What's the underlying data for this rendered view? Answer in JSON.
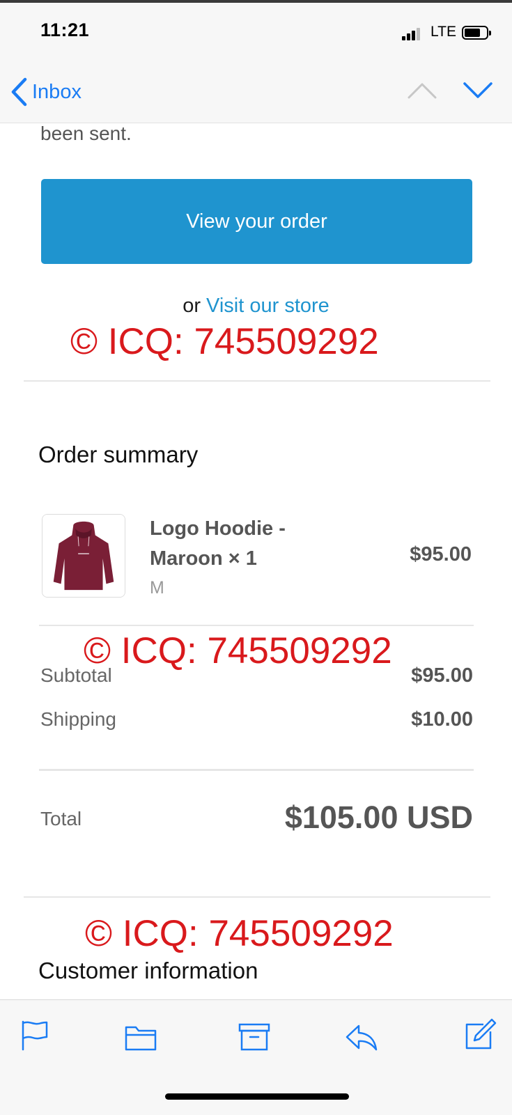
{
  "status_bar": {
    "time": "11:21",
    "network": "LTE"
  },
  "nav": {
    "back_label": "Inbox"
  },
  "email": {
    "sent_text": "been sent.",
    "view_order_label": "View your order",
    "or_text": "or",
    "visit_store_label": "Visit our store",
    "watermark_text": "© ICQ: 745509292",
    "order_summary_title": "Order summary",
    "item": {
      "name": "Logo Hoodie - Maroon × 1",
      "variant": "M",
      "price": "$95.00"
    },
    "subtotal_label": "Subtotal",
    "subtotal_value": "$95.00",
    "shipping_label": "Shipping",
    "shipping_value": "$10.00",
    "total_label": "Total",
    "total_value": "$105.00 USD",
    "customer_info_title": "Customer information"
  },
  "toolbar": {
    "icons": [
      "flag-icon",
      "folder-icon",
      "archive-icon",
      "reply-icon",
      "compose-icon"
    ]
  },
  "colors": {
    "accent_blue": "#1a7cf4",
    "button_blue": "#1f94cf",
    "watermark_red": "#d9191c",
    "hoodie_maroon": "#7a1f36"
  }
}
